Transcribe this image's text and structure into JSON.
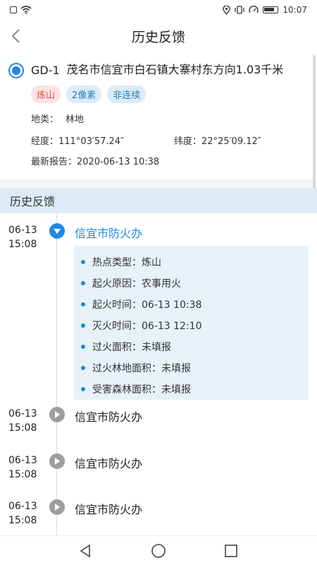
{
  "status_bar": {
    "time": "10:07"
  },
  "header": {
    "title": "历史反馈"
  },
  "card": {
    "id": "GD-1",
    "location": "茂名市信宜市白石镇大寨村东方向1.03千米",
    "tags": [
      "炼山",
      "2像素",
      "非连续"
    ],
    "land_label": "地类：",
    "land_value": "林地",
    "lng_label": "经度：",
    "lng_value": "111°03′57.24″",
    "lat_label": "纬度：",
    "lat_value": "22°25′09.12″",
    "report_label": "最新报告：",
    "report_value": "2020-06-13 10:38"
  },
  "section": {
    "title": "历史反馈"
  },
  "timeline": [
    {
      "date": "06-13",
      "time": "15:08",
      "org": "信宜市防火办",
      "expanded": true,
      "details": [
        "热点类型：炼山",
        "起火原因：农事用火",
        "起火时间：06-13 10:38",
        "灭火时间：06-13 12:10",
        "过火面积：未填报",
        "过火林地面积：未填报",
        "受害森林面积：未填报"
      ]
    },
    {
      "date": "06-13",
      "time": "15:08",
      "org": "信宜市防火办",
      "expanded": false
    },
    {
      "date": "06-13",
      "time": "15:08",
      "org": "信宜市防火办",
      "expanded": false
    },
    {
      "date": "06-13",
      "time": "15:08",
      "org": "信宜市防火办",
      "expanded": false
    }
  ],
  "colors": {
    "accent": "#1e88e5",
    "section_bg": "#dcebf5",
    "tag_red": "#d9534f"
  },
  "icons": [
    "back-arrow-icon",
    "wifi-icon",
    "location-icon",
    "vibrate-icon",
    "speed-icon",
    "battery-icon",
    "expand-down-icon",
    "play-right-icon",
    "nav-back-icon",
    "nav-home-icon",
    "nav-recent-icon"
  ]
}
